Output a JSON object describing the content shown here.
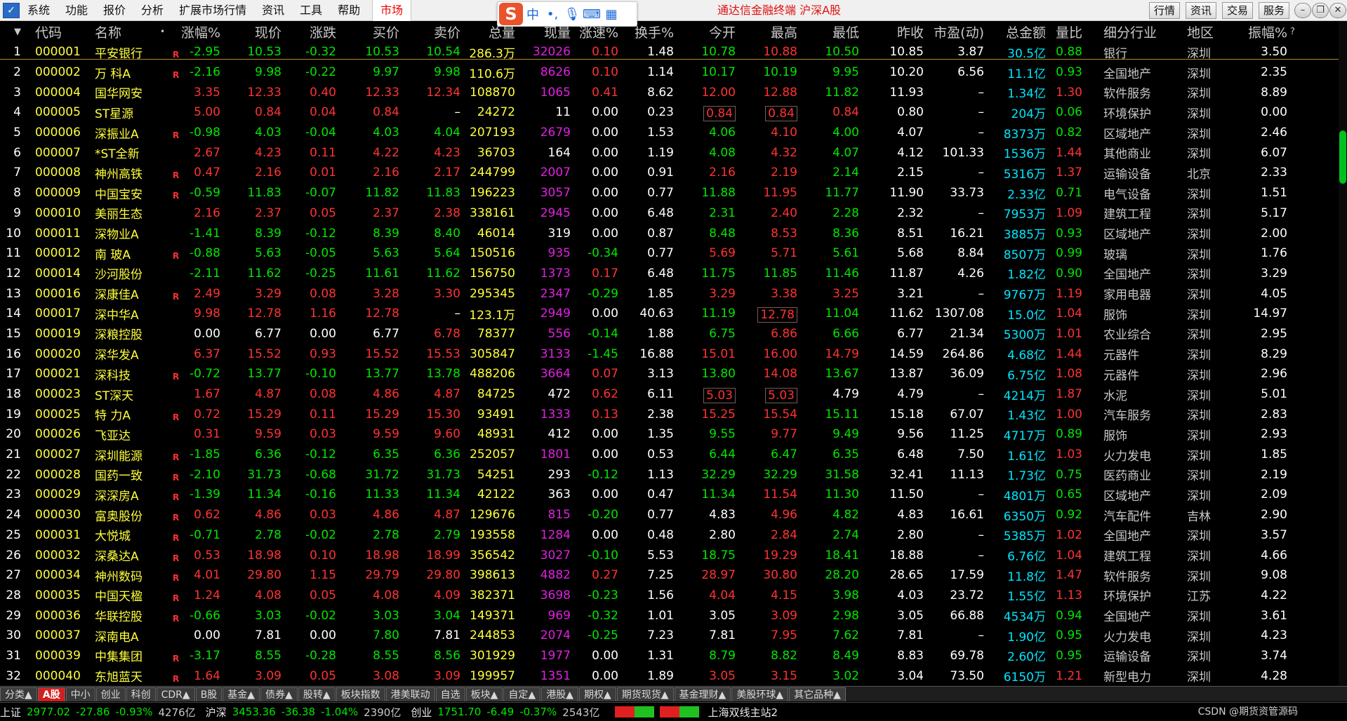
{
  "menu": [
    "系统",
    "功能",
    "报价",
    "分析",
    "扩展市场行情",
    "资讯",
    "工具",
    "帮助"
  ],
  "market_tab": "市场",
  "ime": {
    "logo": "S",
    "mode": "中"
  },
  "window_title": "通达信金融终端  沪深A股",
  "toolbar_buttons": [
    "行情",
    "资讯",
    "交易",
    "服务"
  ],
  "table": {
    "headers": [
      "",
      "代码",
      "名称",
      "",
      "涨幅%",
      "现价",
      "涨跌",
      "买价",
      "卖价",
      "总量",
      "现量",
      "涨速%",
      "换手%",
      "今开",
      "最高",
      "最低",
      "昨收",
      "市盈(动)",
      "总金额",
      "量比",
      "细分行业",
      "地区",
      "振幅%",
      "?"
    ],
    "rows": [
      {
        "n": "1",
        "code": "000001",
        "name": "平安银行",
        "r": "R",
        "pct": "-2.95",
        "price": "10.53",
        "chg": "-0.32",
        "bid": "10.53",
        "ask": "10.54",
        "vol": "286.3万",
        "cur": "32026",
        "spd": "0.10",
        "turn": "1.48",
        "open": "10.78",
        "high": "10.88",
        "low": "10.50",
        "prev": "10.85",
        "pe": "3.87",
        "amt": "30.5亿",
        "vr": "0.88",
        "ind": "银行",
        "area": "深圳",
        "amp": "3.50"
      },
      {
        "n": "2",
        "code": "000002",
        "name": "万 科A",
        "r": "R",
        "pct": "-2.16",
        "price": "9.98",
        "chg": "-0.22",
        "bid": "9.97",
        "ask": "9.98",
        "vol": "110.6万",
        "cur": "8626",
        "spd": "0.10",
        "turn": "1.14",
        "open": "10.17",
        "high": "10.19",
        "low": "9.95",
        "prev": "10.20",
        "pe": "6.56",
        "amt": "11.1亿",
        "vr": "0.93",
        "ind": "全国地产",
        "area": "深圳",
        "amp": "2.35"
      },
      {
        "n": "3",
        "code": "000004",
        "name": "国华网安",
        "r": "",
        "pct": "3.35",
        "price": "12.33",
        "chg": "0.40",
        "bid": "12.33",
        "ask": "12.34",
        "vol": "108870",
        "cur": "1065",
        "spd": "0.41",
        "turn": "8.62",
        "open": "12.00",
        "high": "12.88",
        "low": "11.82",
        "prev": "11.93",
        "pe": "–",
        "amt": "1.34亿",
        "vr": "1.30",
        "ind": "软件服务",
        "area": "深圳",
        "amp": "8.89"
      },
      {
        "n": "4",
        "code": "000005",
        "name": "ST星源",
        "r": "",
        "pct": "5.00",
        "price": "0.84",
        "chg": "0.04",
        "bid": "0.84",
        "ask": "–",
        "vol": "24272",
        "cur": "11",
        "spd": "0.00",
        "turn": "0.23",
        "open": "0.84",
        "high": "0.84",
        "low": "0.84",
        "prev": "0.80",
        "pe": "–",
        "amt": "204万",
        "vr": "0.06",
        "ind": "环境保护",
        "area": "深圳",
        "amp": "0.00"
      },
      {
        "n": "5",
        "code": "000006",
        "name": "深振业A",
        "r": "R",
        "pct": "-0.98",
        "price": "4.03",
        "chg": "-0.04",
        "bid": "4.03",
        "ask": "4.04",
        "vol": "207193",
        "cur": "2679",
        "spd": "0.00",
        "turn": "1.53",
        "open": "4.06",
        "high": "4.10",
        "low": "4.00",
        "prev": "4.07",
        "pe": "–",
        "amt": "8373万",
        "vr": "0.82",
        "ind": "区域地产",
        "area": "深圳",
        "amp": "2.46"
      },
      {
        "n": "6",
        "code": "000007",
        "name": "*ST全新",
        "r": "",
        "pct": "2.67",
        "price": "4.23",
        "chg": "0.11",
        "bid": "4.22",
        "ask": "4.23",
        "vol": "36703",
        "cur": "164",
        "spd": "0.00",
        "turn": "1.19",
        "open": "4.08",
        "high": "4.32",
        "low": "4.07",
        "prev": "4.12",
        "pe": "101.33",
        "amt": "1536万",
        "vr": "1.44",
        "ind": "其他商业",
        "area": "深圳",
        "amp": "6.07"
      },
      {
        "n": "7",
        "code": "000008",
        "name": "神州高铁",
        "r": "R",
        "pct": "0.47",
        "price": "2.16",
        "chg": "0.01",
        "bid": "2.16",
        "ask": "2.17",
        "vol": "244799",
        "cur": "2007",
        "spd": "0.00",
        "turn": "0.91",
        "open": "2.16",
        "high": "2.19",
        "low": "2.14",
        "prev": "2.15",
        "pe": "–",
        "amt": "5316万",
        "vr": "1.37",
        "ind": "运输设备",
        "area": "北京",
        "amp": "2.33"
      },
      {
        "n": "8",
        "code": "000009",
        "name": "中国宝安",
        "r": "R",
        "pct": "-0.59",
        "price": "11.83",
        "chg": "-0.07",
        "bid": "11.82",
        "ask": "11.83",
        "vol": "196223",
        "cur": "3057",
        "spd": "0.00",
        "turn": "0.77",
        "open": "11.88",
        "high": "11.95",
        "low": "11.77",
        "prev": "11.90",
        "pe": "33.73",
        "amt": "2.33亿",
        "vr": "0.71",
        "ind": "电气设备",
        "area": "深圳",
        "amp": "1.51"
      },
      {
        "n": "9",
        "code": "000010",
        "name": "美丽生态",
        "r": "",
        "pct": "2.16",
        "price": "2.37",
        "chg": "0.05",
        "bid": "2.37",
        "ask": "2.38",
        "vol": "338161",
        "cur": "2945",
        "spd": "0.00",
        "turn": "6.48",
        "open": "2.31",
        "high": "2.40",
        "low": "2.28",
        "prev": "2.32",
        "pe": "–",
        "amt": "7953万",
        "vr": "1.09",
        "ind": "建筑工程",
        "area": "深圳",
        "amp": "5.17"
      },
      {
        "n": "10",
        "code": "000011",
        "name": "深物业A",
        "r": "",
        "pct": "-1.41",
        "price": "8.39",
        "chg": "-0.12",
        "bid": "8.39",
        "ask": "8.40",
        "vol": "46014",
        "cur": "319",
        "spd": "0.00",
        "turn": "0.87",
        "open": "8.48",
        "high": "8.53",
        "low": "8.36",
        "prev": "8.51",
        "pe": "16.21",
        "amt": "3885万",
        "vr": "0.93",
        "ind": "区域地产",
        "area": "深圳",
        "amp": "2.00"
      },
      {
        "n": "11",
        "code": "000012",
        "name": "南 玻A",
        "r": "R",
        "pct": "-0.88",
        "price": "5.63",
        "chg": "-0.05",
        "bid": "5.63",
        "ask": "5.64",
        "vol": "150516",
        "cur": "935",
        "spd": "-0.34",
        "turn": "0.77",
        "open": "5.69",
        "high": "5.71",
        "low": "5.61",
        "prev": "5.68",
        "pe": "8.84",
        "amt": "8507万",
        "vr": "0.99",
        "ind": "玻璃",
        "area": "深圳",
        "amp": "1.76"
      },
      {
        "n": "12",
        "code": "000014",
        "name": "沙河股份",
        "r": "",
        "pct": "-2.11",
        "price": "11.62",
        "chg": "-0.25",
        "bid": "11.61",
        "ask": "11.62",
        "vol": "156750",
        "cur": "1373",
        "spd": "0.17",
        "turn": "6.48",
        "open": "11.75",
        "high": "11.85",
        "low": "11.46",
        "prev": "11.87",
        "pe": "4.26",
        "amt": "1.82亿",
        "vr": "0.90",
        "ind": "全国地产",
        "area": "深圳",
        "amp": "3.29"
      },
      {
        "n": "13",
        "code": "000016",
        "name": "深康佳A",
        "r": "R",
        "pct": "2.49",
        "price": "3.29",
        "chg": "0.08",
        "bid": "3.28",
        "ask": "3.30",
        "vol": "295345",
        "cur": "2347",
        "spd": "-0.29",
        "turn": "1.85",
        "open": "3.29",
        "high": "3.38",
        "low": "3.25",
        "prev": "3.21",
        "pe": "–",
        "amt": "9767万",
        "vr": "1.19",
        "ind": "家用电器",
        "area": "深圳",
        "amp": "4.05"
      },
      {
        "n": "14",
        "code": "000017",
        "name": "深中华A",
        "r": "",
        "pct": "9.98",
        "price": "12.78",
        "chg": "1.16",
        "bid": "12.78",
        "ask": "–",
        "vol": "123.1万",
        "cur": "2949",
        "spd": "0.00",
        "turn": "40.63",
        "open": "11.19",
        "high": "12.78",
        "low": "11.04",
        "prev": "11.62",
        "pe": "1307.08",
        "amt": "15.0亿",
        "vr": "1.04",
        "ind": "服饰",
        "area": "深圳",
        "amp": "14.97"
      },
      {
        "n": "15",
        "code": "000019",
        "name": "深粮控股",
        "r": "",
        "pct": "0.00",
        "price": "6.77",
        "chg": "0.00",
        "bid": "6.77",
        "ask": "6.78",
        "vol": "78377",
        "cur": "556",
        "spd": "-0.14",
        "turn": "1.88",
        "open": "6.75",
        "high": "6.86",
        "low": "6.66",
        "prev": "6.77",
        "pe": "21.34",
        "amt": "5300万",
        "vr": "1.01",
        "ind": "农业综合",
        "area": "深圳",
        "amp": "2.95"
      },
      {
        "n": "16",
        "code": "000020",
        "name": "深华发A",
        "r": "",
        "pct": "6.37",
        "price": "15.52",
        "chg": "0.93",
        "bid": "15.52",
        "ask": "15.53",
        "vol": "305847",
        "cur": "3133",
        "spd": "-1.45",
        "turn": "16.88",
        "open": "15.01",
        "high": "16.00",
        "low": "14.79",
        "prev": "14.59",
        "pe": "264.86",
        "amt": "4.68亿",
        "vr": "1.44",
        "ind": "元器件",
        "area": "深圳",
        "amp": "8.29"
      },
      {
        "n": "17",
        "code": "000021",
        "name": "深科技",
        "r": "R",
        "pct": "-0.72",
        "price": "13.77",
        "chg": "-0.10",
        "bid": "13.77",
        "ask": "13.78",
        "vol": "488206",
        "cur": "3664",
        "spd": "0.07",
        "turn": "3.13",
        "open": "13.80",
        "high": "14.08",
        "low": "13.67",
        "prev": "13.87",
        "pe": "36.09",
        "amt": "6.75亿",
        "vr": "1.08",
        "ind": "元器件",
        "area": "深圳",
        "amp": "2.96"
      },
      {
        "n": "18",
        "code": "000023",
        "name": "ST深天",
        "r": "",
        "pct": "1.67",
        "price": "4.87",
        "chg": "0.08",
        "bid": "4.86",
        "ask": "4.87",
        "vol": "84725",
        "cur": "472",
        "spd": "0.62",
        "turn": "6.11",
        "open": "5.03",
        "high": "5.03",
        "low": "4.79",
        "prev": "4.79",
        "pe": "–",
        "amt": "4214万",
        "vr": "1.87",
        "ind": "水泥",
        "area": "深圳",
        "amp": "5.01"
      },
      {
        "n": "19",
        "code": "000025",
        "name": "特 力A",
        "r": "R",
        "pct": "0.72",
        "price": "15.29",
        "chg": "0.11",
        "bid": "15.29",
        "ask": "15.30",
        "vol": "93491",
        "cur": "1333",
        "spd": "0.13",
        "turn": "2.38",
        "open": "15.25",
        "high": "15.54",
        "low": "15.11",
        "prev": "15.18",
        "pe": "67.07",
        "amt": "1.43亿",
        "vr": "1.00",
        "ind": "汽车服务",
        "area": "深圳",
        "amp": "2.83"
      },
      {
        "n": "20",
        "code": "000026",
        "name": "飞亚达",
        "r": "",
        "pct": "0.31",
        "price": "9.59",
        "chg": "0.03",
        "bid": "9.59",
        "ask": "9.60",
        "vol": "48931",
        "cur": "412",
        "spd": "0.00",
        "turn": "1.35",
        "open": "9.55",
        "high": "9.77",
        "low": "9.49",
        "prev": "9.56",
        "pe": "11.25",
        "amt": "4717万",
        "vr": "0.89",
        "ind": "服饰",
        "area": "深圳",
        "amp": "2.93"
      },
      {
        "n": "21",
        "code": "000027",
        "name": "深圳能源",
        "r": "R",
        "pct": "-1.85",
        "price": "6.36",
        "chg": "-0.12",
        "bid": "6.35",
        "ask": "6.36",
        "vol": "252057",
        "cur": "1801",
        "spd": "0.00",
        "turn": "0.53",
        "open": "6.44",
        "high": "6.47",
        "low": "6.35",
        "prev": "6.48",
        "pe": "7.50",
        "amt": "1.61亿",
        "vr": "1.03",
        "ind": "火力发电",
        "area": "深圳",
        "amp": "1.85"
      },
      {
        "n": "22",
        "code": "000028",
        "name": "国药一致",
        "r": "R",
        "pct": "-2.10",
        "price": "31.73",
        "chg": "-0.68",
        "bid": "31.72",
        "ask": "31.73",
        "vol": "54251",
        "cur": "293",
        "spd": "-0.12",
        "turn": "1.13",
        "open": "32.29",
        "high": "32.29",
        "low": "31.58",
        "prev": "32.41",
        "pe": "11.13",
        "amt": "1.73亿",
        "vr": "0.75",
        "ind": "医药商业",
        "area": "深圳",
        "amp": "2.19"
      },
      {
        "n": "23",
        "code": "000029",
        "name": "深深房A",
        "r": "R",
        "pct": "-1.39",
        "price": "11.34",
        "chg": "-0.16",
        "bid": "11.33",
        "ask": "11.34",
        "vol": "42122",
        "cur": "363",
        "spd": "0.00",
        "turn": "0.47",
        "open": "11.34",
        "high": "11.54",
        "low": "11.30",
        "prev": "11.50",
        "pe": "–",
        "amt": "4801万",
        "vr": "0.65",
        "ind": "区域地产",
        "area": "深圳",
        "amp": "2.09"
      },
      {
        "n": "24",
        "code": "000030",
        "name": "富奥股份",
        "r": "R",
        "pct": "0.62",
        "price": "4.86",
        "chg": "0.03",
        "bid": "4.86",
        "ask": "4.87",
        "vol": "129676",
        "cur": "815",
        "spd": "-0.20",
        "turn": "0.77",
        "open": "4.83",
        "high": "4.96",
        "low": "4.82",
        "prev": "4.83",
        "pe": "16.61",
        "amt": "6350万",
        "vr": "0.92",
        "ind": "汽车配件",
        "area": "吉林",
        "amp": "2.90"
      },
      {
        "n": "25",
        "code": "000031",
        "name": "大悦城",
        "r": "R",
        "pct": "-0.71",
        "price": "2.78",
        "chg": "-0.02",
        "bid": "2.78",
        "ask": "2.79",
        "vol": "193558",
        "cur": "1284",
        "spd": "0.00",
        "turn": "0.48",
        "open": "2.80",
        "high": "2.84",
        "low": "2.74",
        "prev": "2.80",
        "pe": "–",
        "amt": "5385万",
        "vr": "1.02",
        "ind": "全国地产",
        "area": "深圳",
        "amp": "3.57"
      },
      {
        "n": "26",
        "code": "000032",
        "name": "深桑达A",
        "r": "R",
        "pct": "0.53",
        "price": "18.98",
        "chg": "0.10",
        "bid": "18.98",
        "ask": "18.99",
        "vol": "356542",
        "cur": "3027",
        "spd": "-0.10",
        "turn": "5.53",
        "open": "18.75",
        "high": "19.29",
        "low": "18.41",
        "prev": "18.88",
        "pe": "–",
        "amt": "6.76亿",
        "vr": "1.04",
        "ind": "建筑工程",
        "area": "深圳",
        "amp": "4.66"
      },
      {
        "n": "27",
        "code": "000034",
        "name": "神州数码",
        "r": "R",
        "pct": "4.01",
        "price": "29.80",
        "chg": "1.15",
        "bid": "29.79",
        "ask": "29.80",
        "vol": "398613",
        "cur": "4882",
        "spd": "0.27",
        "turn": "7.25",
        "open": "28.97",
        "high": "30.80",
        "low": "28.20",
        "prev": "28.65",
        "pe": "17.59",
        "amt": "11.8亿",
        "vr": "1.47",
        "ind": "软件服务",
        "area": "深圳",
        "amp": "9.08"
      },
      {
        "n": "28",
        "code": "000035",
        "name": "中国天楹",
        "r": "R",
        "pct": "1.24",
        "price": "4.08",
        "chg": "0.05",
        "bid": "4.08",
        "ask": "4.09",
        "vol": "382371",
        "cur": "3698",
        "spd": "-0.23",
        "turn": "1.56",
        "open": "4.04",
        "high": "4.15",
        "low": "3.98",
        "prev": "4.03",
        "pe": "23.72",
        "amt": "1.55亿",
        "vr": "1.13",
        "ind": "环境保护",
        "area": "江苏",
        "amp": "4.22"
      },
      {
        "n": "29",
        "code": "000036",
        "name": "华联控股",
        "r": "R",
        "pct": "-0.66",
        "price": "3.03",
        "chg": "-0.02",
        "bid": "3.03",
        "ask": "3.04",
        "vol": "149371",
        "cur": "969",
        "spd": "-0.32",
        "turn": "1.01",
        "open": "3.05",
        "high": "3.09",
        "low": "2.98",
        "prev": "3.05",
        "pe": "66.88",
        "amt": "4534万",
        "vr": "0.94",
        "ind": "全国地产",
        "area": "深圳",
        "amp": "3.61"
      },
      {
        "n": "30",
        "code": "000037",
        "name": "深南电A",
        "r": "",
        "pct": "0.00",
        "price": "7.81",
        "chg": "0.00",
        "bid": "7.80",
        "ask": "7.81",
        "vol": "244853",
        "cur": "2074",
        "spd": "-0.25",
        "turn": "7.23",
        "open": "7.81",
        "high": "7.95",
        "low": "7.62",
        "prev": "7.81",
        "pe": "–",
        "amt": "1.90亿",
        "vr": "0.95",
        "ind": "火力发电",
        "area": "深圳",
        "amp": "4.23"
      },
      {
        "n": "31",
        "code": "000039",
        "name": "中集集团",
        "r": "R",
        "pct": "-3.17",
        "price": "8.55",
        "chg": "-0.28",
        "bid": "8.55",
        "ask": "8.56",
        "vol": "301929",
        "cur": "1977",
        "spd": "0.00",
        "turn": "1.31",
        "open": "8.79",
        "high": "8.82",
        "low": "8.49",
        "prev": "8.83",
        "pe": "69.78",
        "amt": "2.60亿",
        "vr": "0.95",
        "ind": "运输设备",
        "area": "深圳",
        "amp": "3.74"
      },
      {
        "n": "32",
        "code": "000040",
        "name": "东旭蓝天",
        "r": "R",
        "pct": "1.64",
        "price": "3.09",
        "chg": "0.05",
        "bid": "3.08",
        "ask": "3.09",
        "vol": "199957",
        "cur": "1351",
        "spd": "0.00",
        "turn": "1.89",
        "open": "3.05",
        "high": "3.15",
        "low": "3.02",
        "prev": "3.04",
        "pe": "73.50",
        "amt": "6150万",
        "vr": "1.21",
        "ind": "新型电力",
        "area": "深圳",
        "amp": "4.28"
      }
    ]
  },
  "tabs": [
    "分类▲",
    "A股",
    "中小",
    "创业",
    "科创",
    "CDR▲",
    "B股",
    "基金▲",
    "债券▲",
    "股转▲",
    "板块指数",
    "港美联动",
    "自选",
    "板块▲",
    "自定▲",
    "港股▲",
    "期权▲",
    "期货现货▲",
    "基金理财▲",
    "美股环球▲",
    "其它品种▲"
  ],
  "status": {
    "sh_label": "上证",
    "sh_val": "2977.02",
    "sh_chg": "-27.86",
    "sh_pct": "-0.93%",
    "sh_amt": "4276亿",
    "hs_label": "沪深",
    "hs_val": "3453.36",
    "hs_chg": "-36.38",
    "hs_pct": "-1.04%",
    "hs_amt": "2390亿",
    "cy_label": "创业",
    "cy_val": "1751.70",
    "cy_chg": "-6.49",
    "cy_pct": "-0.37%",
    "cy_amt": "2543亿",
    "server": "上海双线主站2"
  },
  "watermark": "CSDN @期货资管源码"
}
